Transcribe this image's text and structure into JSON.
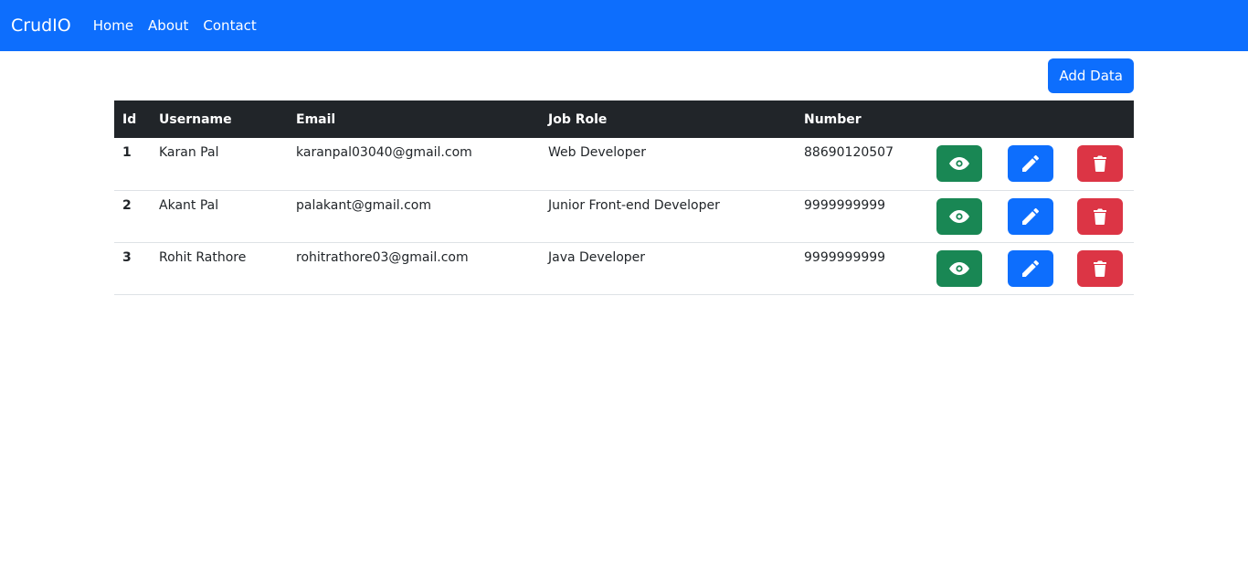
{
  "navbar": {
    "brand": "CrudIO",
    "links": [
      "Home",
      "About",
      "Contact"
    ]
  },
  "toolbar": {
    "add_label": "Add Data"
  },
  "table": {
    "headers": [
      "Id",
      "Username",
      "Email",
      "Job Role",
      "Number"
    ],
    "rows": [
      {
        "id": "1",
        "username": "Karan Pal",
        "email": "karanpal03040@gmail.com",
        "role": "Web Developer",
        "number": "88690120507"
      },
      {
        "id": "2",
        "username": "Akant Pal",
        "email": "palakant@gmail.com",
        "role": "Junior Front-end Developer",
        "number": "9999999999"
      },
      {
        "id": "3",
        "username": "Rohit Rathore",
        "email": "rohitrathore03@gmail.com",
        "role": "Java Developer",
        "number": "9999999999"
      }
    ]
  },
  "icons": {
    "view": "eye-icon",
    "edit": "pencil-icon",
    "delete": "trash-icon"
  },
  "colors": {
    "primary": "#0d6efd",
    "success": "#198754",
    "danger": "#dc3545",
    "dark": "#212529"
  }
}
